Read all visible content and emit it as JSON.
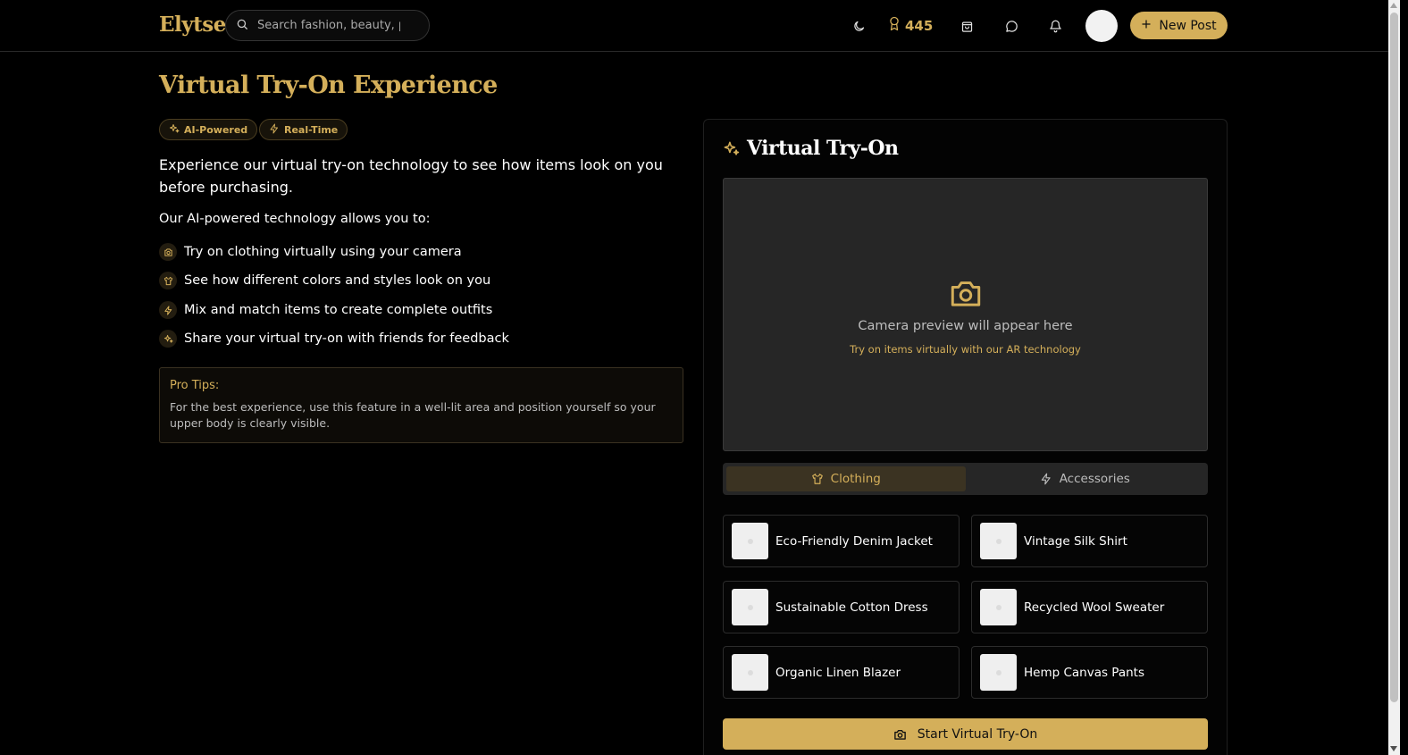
{
  "header": {
    "logo": "Elytse",
    "search_placeholder": "Search fashion, beauty, p",
    "points": "445",
    "new_post_label": "New Post"
  },
  "main": {
    "title": "Virtual Try-On Experience",
    "badges": [
      "AI-Powered",
      "Real-Time"
    ],
    "intro": "Experience our virtual try-on technology to see how items look on you before purchasing.",
    "subhead": "Our AI-powered technology allows you to:",
    "features": [
      "Try on clothing virtually using your camera",
      "See how different colors and styles look on you",
      "Mix and match items to create complete outfits",
      "Share your virtual try-on with friends for feedback"
    ],
    "tips": {
      "title": "Pro Tips:",
      "body": "For the best experience, use this feature in a well-lit area and position yourself so your upper body is clearly visible."
    }
  },
  "panel": {
    "title": "Virtual Try-On",
    "camera_text": "Camera preview will appear here",
    "camera_sub": "Try on items virtually with our AR technology",
    "tabs": [
      "Clothing",
      "Accessories"
    ],
    "items": [
      "Eco-Friendly Denim Jacket",
      "Vintage Silk Shirt",
      "Sustainable Cotton Dress",
      "Recycled Wool Sweater",
      "Organic Linen Blazer",
      "Hemp Canvas Pants"
    ],
    "start_label": "Start Virtual Try-On"
  },
  "colors": {
    "accent": "#d4af5a",
    "background": "#000000",
    "surface": "#262626"
  }
}
